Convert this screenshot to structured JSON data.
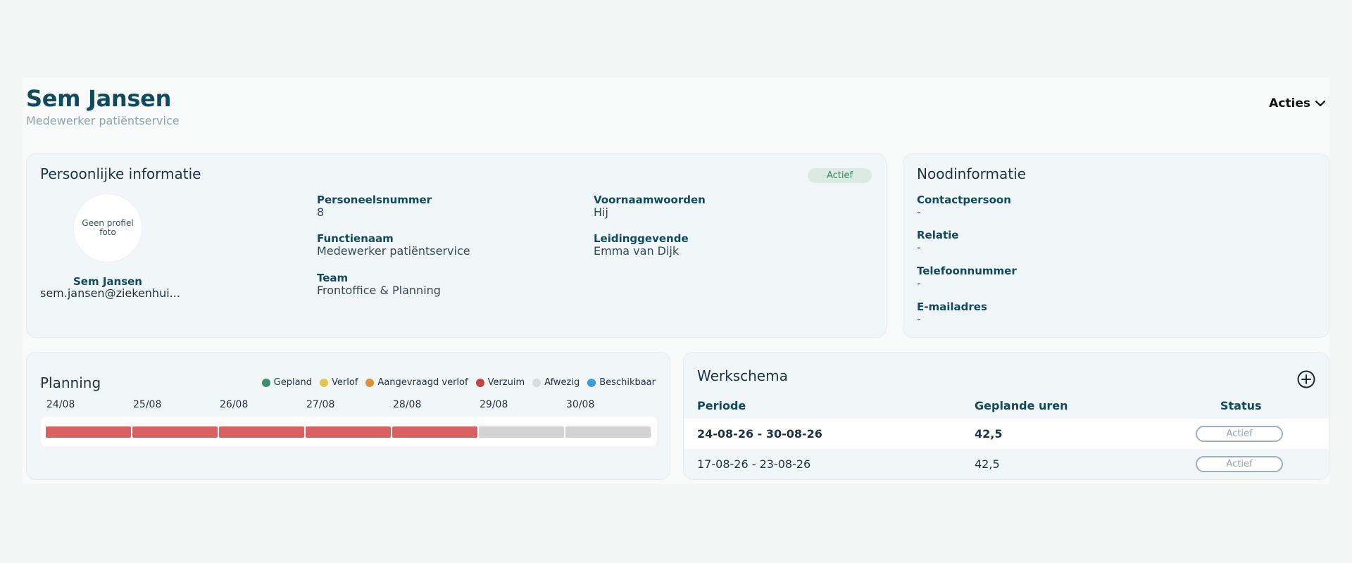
{
  "header": {
    "name": "Sem Jansen",
    "role": "Medewerker patiëntservice",
    "actions_label": "Acties"
  },
  "personal": {
    "title": "Persoonlijke informatie",
    "status": "Actief",
    "avatar_text": "Geen profiel foto",
    "name": "Sem Jansen",
    "email": "sem.jansen@ziekenhui...",
    "fields": {
      "personeelsnummer": {
        "label": "Personeelsnummer",
        "value": "8"
      },
      "functienaam": {
        "label": "Functienaam",
        "value": "Medewerker patiëntservice"
      },
      "team": {
        "label": "Team",
        "value": "Frontoffice & Planning"
      },
      "voornaamwoorden": {
        "label": "Voornaamwoorden",
        "value": "Hij"
      },
      "leidinggevende": {
        "label": "Leidinggevende",
        "value": "Emma van Dijk"
      }
    }
  },
  "emergency": {
    "title": "Noodinformatie",
    "fields": [
      {
        "label": "Contactpersoon",
        "value": "-"
      },
      {
        "label": "Relatie",
        "value": "-"
      },
      {
        "label": "Telefoonnummer",
        "value": "-"
      },
      {
        "label": "E-mailadres",
        "value": "-"
      }
    ]
  },
  "planning": {
    "title": "Planning",
    "legend": [
      {
        "label": "Gepland",
        "color": "#3c8f66"
      },
      {
        "label": "Verlof",
        "color": "#e8c44d"
      },
      {
        "label": "Aangevraagd verlof",
        "color": "#e28e3a"
      },
      {
        "label": "Verzuim",
        "color": "#c9443e"
      },
      {
        "label": "Afwezig",
        "color": "#dadcdd"
      },
      {
        "label": "Beschikbaar",
        "color": "#3a9fd8"
      }
    ],
    "days": [
      {
        "date": "24/08",
        "status": "Verzuim"
      },
      {
        "date": "25/08",
        "status": "Verzuim"
      },
      {
        "date": "26/08",
        "status": "Verzuim"
      },
      {
        "date": "27/08",
        "status": "Verzuim"
      },
      {
        "date": "28/08",
        "status": "Verzuim"
      },
      {
        "date": "29/08",
        "status": "Afwezig"
      },
      {
        "date": "30/08",
        "status": "Afwezig"
      }
    ],
    "bar_colors": {
      "Verzuim": "#d8615f",
      "Afwezig": "#d3d3d3"
    }
  },
  "schedule": {
    "title": "Werkschema",
    "columns": [
      "Periode",
      "Geplande uren",
      "Status"
    ],
    "rows": [
      {
        "period": "24-08-26 - 30-08-26",
        "hours": "42,5",
        "status": "Actief"
      },
      {
        "period": "17-08-26 - 23-08-26",
        "hours": "42,5",
        "status": "Actief"
      }
    ]
  }
}
